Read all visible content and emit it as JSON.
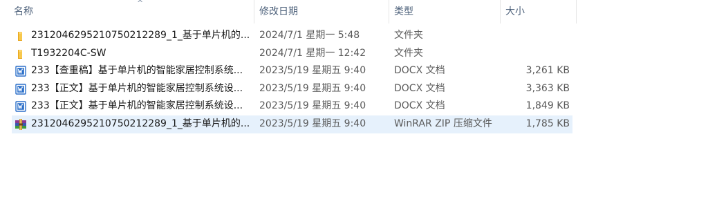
{
  "columns": {
    "name": "名称",
    "modified": "修改日期",
    "type": "类型",
    "size": "大小"
  },
  "sort_indicator": "^",
  "files": [
    {
      "name": "2312046295210750212289_1_基于单片机的...",
      "modified": "2024/7/1 星期一 5:48",
      "type": "文件夹",
      "size": "",
      "icon": "folder-icon"
    },
    {
      "name": "T1932204C-SW",
      "modified": "2024/7/1 星期一 12:42",
      "type": "文件夹",
      "size": "",
      "icon": "folder-icon"
    },
    {
      "name": "233【查重稿】基于单片机的智能家居控制系统...",
      "modified": "2023/5/19 星期五 9:40",
      "type": "DOCX 文档",
      "size": "3,261 KB",
      "icon": "word-doc-icon"
    },
    {
      "name": "233【正文】基于单片机的智能家居控制系统设...",
      "modified": "2023/5/19 星期五 9:40",
      "type": "DOCX 文档",
      "size": "3,363 KB",
      "icon": "word-doc-icon"
    },
    {
      "name": "233【正文】基于单片机的智能家居控制系统设...",
      "modified": "2023/5/19 星期五 9:40",
      "type": "DOCX 文档",
      "size": "1,849 KB",
      "icon": "word-doc-icon"
    },
    {
      "name": "2312046295210750212289_1_基于单片机的...",
      "modified": "2023/5/19 星期五 9:40",
      "type": "WinRAR ZIP 压缩文件",
      "size": "1,785 KB",
      "icon": "winrar-archive-icon",
      "selected": true
    }
  ]
}
